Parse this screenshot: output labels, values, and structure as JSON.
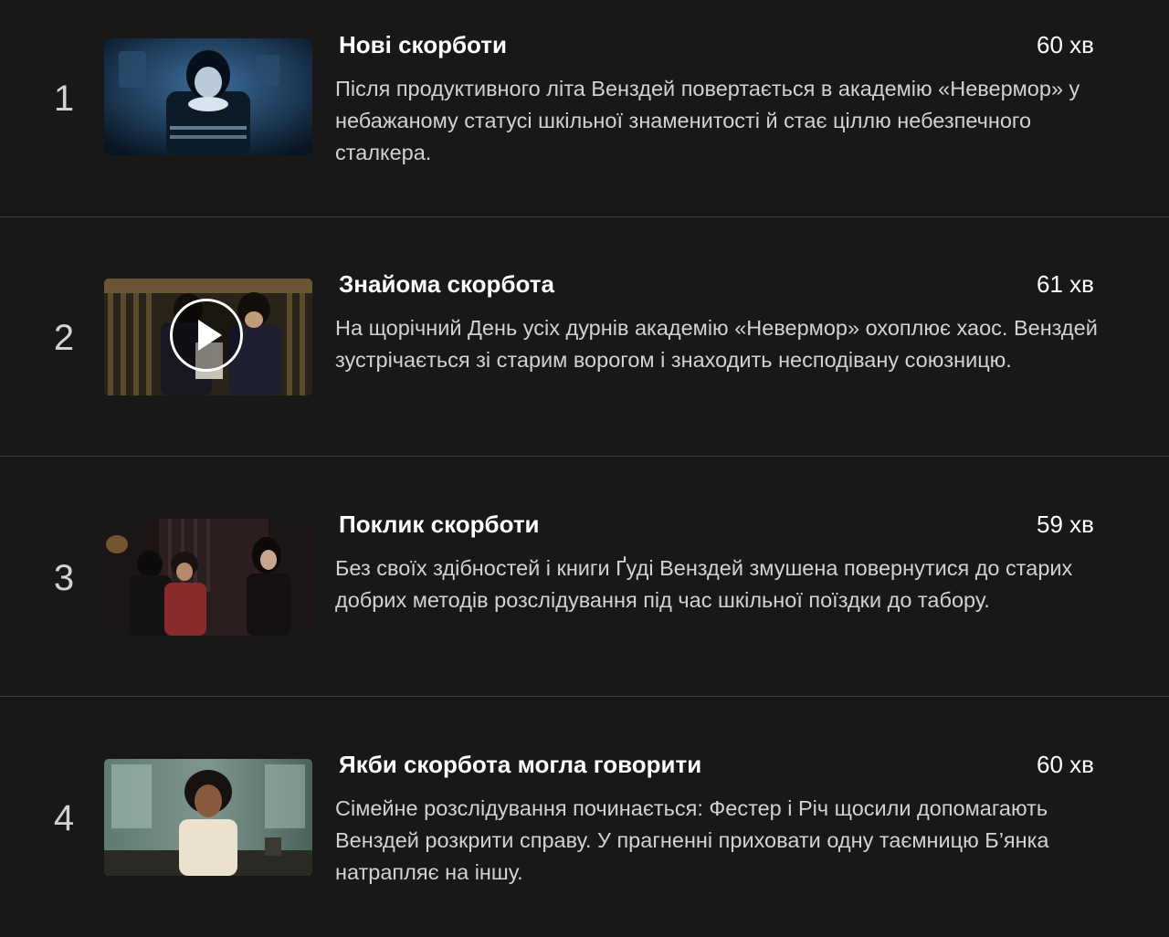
{
  "episodes": [
    {
      "index": "1",
      "title": "Нові скорботи",
      "duration": "60 хв",
      "description": "Після продуктивного літа Венздей повертається в академію «Невермор» у небажаному статусі шкільної знаменитості й стає ціллю небезпечного сталкера."
    },
    {
      "index": "2",
      "title": "Знайома скорбота",
      "duration": "61 хв",
      "description": "На щорічний День усіх дурнів академію «Невермор» охоплює хаос. Венздей зустрічається зі старим ворогом і знаходить несподівану союзницю."
    },
    {
      "index": "3",
      "title": "Поклик скорботи",
      "duration": "59 хв",
      "description": "Без своїх здібностей і книги Ґуді Венздей змушена повернутися до старих добрих методів розслідування під час шкільної поїздки до табору."
    },
    {
      "index": "4",
      "title": "Якби скорбота могла говорити",
      "duration": "60 хв",
      "description": "Сімейне розслідування починається: Фестер і Річ щосили допомагають Венздей розкрити справу. У прагненні приховати одну таємницю Б’янка натрапляє на іншу."
    }
  ],
  "colors": {
    "background": "#181818",
    "divider": "#404040",
    "title": "#ffffff",
    "description": "#d2d2d2",
    "index": "#d2d2d2"
  },
  "icons": {
    "play": "play-icon"
  }
}
